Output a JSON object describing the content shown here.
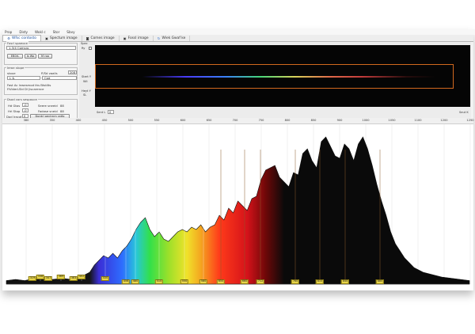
{
  "menu": [
    "Prop",
    "Disty",
    "Wokl c",
    "Stor",
    "Sbvy"
  ],
  "tabs": [
    {
      "label": "Wfsc contosto",
      "icon": "settings-icon"
    },
    {
      "label": "Spectum image",
      "icon": "image-icon"
    },
    {
      "label": "Comes image",
      "icon": "camera-icon"
    },
    {
      "label": "Fossl image",
      "icon": "image-icon"
    },
    {
      "label": "Wiek Gwaf ke",
      "icon": "refresh-icon"
    }
  ],
  "left": {
    "g1_title": "Fosrl spaeoce",
    "camera_select": "1.3/4 Comsro",
    "buttons": [
      "EB0rL",
      "Is Wo",
      "M roo"
    ],
    "g2_title": "Ieroe stope",
    "status_label": "stoue",
    "px_label": "P/Sd vaalis",
    "px_value": "208",
    "mode_value": "L &",
    "mode_value2": "Cod",
    "note_line1": "Fast Ac lnwesmod ths Btstllts",
    "note_line2": "FiViderLSld Dl Jiscarence",
    "g3_title": "Dsod cors sespouce",
    "r1_label": "Hd Gtos",
    "r1_value": "-0",
    "r1_label2": "Seere sneeid",
    "r1_value2": "88",
    "r2_label": "Hrl Stop",
    "r2_value": "-0",
    "r2_label2": "Fadase sneid",
    "r2_value2": "88",
    "r3_label": "Dod Iracaty",
    "r3_value": "0",
    "r3_button": "Dontrl oectrnm ratfo"
  },
  "preview": {
    "label_top": "Spec",
    "label_ry": "Ry",
    "label_start": "Stert Y",
    "start_val": "Wii",
    "label_end": "Heyt Y",
    "end_val": "SL",
    "bottom_label": "Sent L",
    "bottom_val": "0",
    "right_label": "Seut K"
  },
  "chart_data": {
    "type": "area",
    "x_ticks": [
      "380",
      "350",
      "400",
      "450",
      "500",
      "550",
      "600",
      "650",
      "700",
      "750",
      "800",
      "850",
      "900",
      "1000",
      "1050",
      "1100",
      "1200",
      "1250"
    ],
    "peaks": [
      "319",
      "338",
      "347",
      "369",
      "383",
      "402",
      "430",
      "456",
      "480",
      "510",
      "550",
      "580",
      "650",
      "660",
      "712",
      "760",
      "810",
      "840",
      "880"
    ],
    "series": [
      {
        "x": [
          0,
          2,
          4,
          6,
          8,
          10,
          12,
          14,
          16,
          18,
          19,
          20,
          21,
          22,
          23,
          24,
          25,
          26,
          27,
          28,
          29,
          30,
          31,
          32,
          33,
          34,
          35,
          36,
          37,
          38,
          39,
          40,
          41,
          42,
          43,
          44,
          45,
          46,
          47,
          48,
          49,
          50,
          51,
          52,
          53,
          54,
          55,
          56,
          57,
          58,
          59,
          60,
          61,
          62,
          63,
          64,
          65,
          66,
          67,
          68,
          69,
          70,
          71,
          72,
          73,
          74,
          75,
          76,
          77,
          78,
          79,
          80,
          81,
          82,
          83,
          84,
          85,
          86,
          87,
          88,
          89,
          90,
          92,
          94,
          96,
          98,
          100
        ],
        "values": [
          3,
          4,
          3,
          5,
          4,
          4,
          5,
          4,
          6,
          10,
          16,
          20,
          24,
          22,
          26,
          22,
          28,
          32,
          38,
          46,
          52,
          56,
          46,
          40,
          44,
          38,
          36,
          40,
          44,
          46,
          44,
          48,
          46,
          50,
          44,
          48,
          50,
          58,
          54,
          64,
          60,
          70,
          66,
          62,
          72,
          74,
          88,
          96,
          98,
          100,
          90,
          86,
          82,
          94,
          92,
          110,
          114,
          104,
          98,
          120,
          124,
          116,
          108,
          106,
          118,
          114,
          104,
          118,
          124,
          114,
          100,
          84,
          70,
          58,
          44,
          34,
          28,
          22,
          18,
          14,
          12,
          10,
          8,
          6,
          5,
          4,
          3
        ]
      }
    ]
  }
}
